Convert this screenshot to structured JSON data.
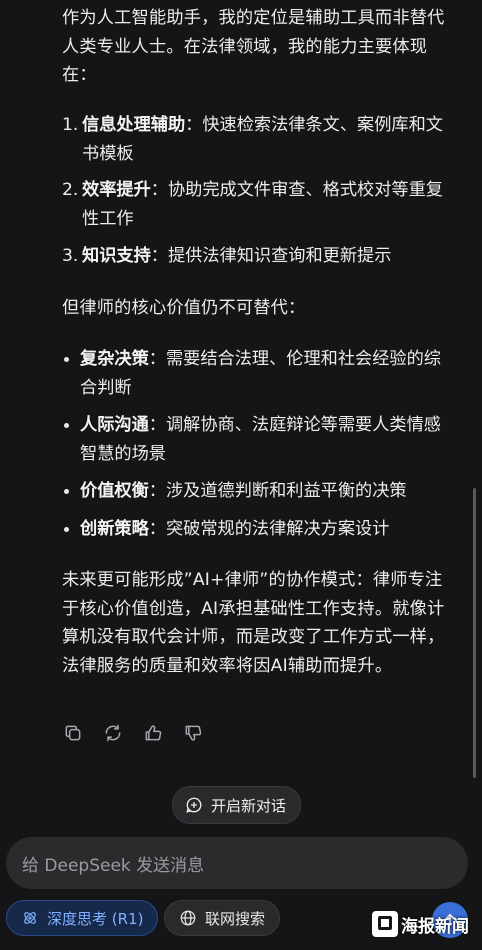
{
  "message": {
    "intro": "作为人工智能助手，我的定位是辅助工具而非替代人类专业人士。在法律领域，我的能力主要体现在：",
    "ordered": [
      {
        "num": "1.",
        "bold": "信息处理辅助",
        "text": "：快速检索法律条文、案例库和文书模板"
      },
      {
        "num": "2.",
        "bold": "效率提升",
        "text": "：协助完成文件审查、格式校对等重复性工作"
      },
      {
        "num": "3.",
        "bold": "知识支持",
        "text": "：提供法律知识查询和更新提示"
      }
    ],
    "middle": "但律师的核心价值仍不可替代：",
    "bullets": [
      {
        "bold": "复杂决策",
        "text": "：需要结合法理、伦理和社会经验的综合判断"
      },
      {
        "bold": "人际沟通",
        "text": "：调解协商、法庭辩论等需要人类情感智慧的场景"
      },
      {
        "bold": "价值权衡",
        "text": "：涉及道德判断和利益平衡的决策"
      },
      {
        "bold": "创新策略",
        "text": "：突破常规的法律解决方案设计"
      }
    ],
    "conclusion": "未来更可能形成”AI+律师”的协作模式：律师专注于核心价值创造，AI承担基础性工作支持。就像计算机没有取代会计师，而是改变了工作方式一样，法律服务的质量和效率将因AI辅助而提升。"
  },
  "actions": {
    "copy_icon": "copy-icon",
    "regenerate_icon": "refresh-icon",
    "like_icon": "thumbs-up-icon",
    "dislike_icon": "thumbs-down-icon"
  },
  "new_chat": {
    "label": "开启新对话"
  },
  "composer": {
    "placeholder": "给 DeepSeek 发送消息",
    "deep_think": "深度思考 (R1)",
    "web_search": "联网搜索"
  },
  "watermark": {
    "text": "海报新闻"
  },
  "colors": {
    "accent": "#3b6fd8",
    "deep_think_text": "#7fb0ff",
    "background": "#151517"
  }
}
